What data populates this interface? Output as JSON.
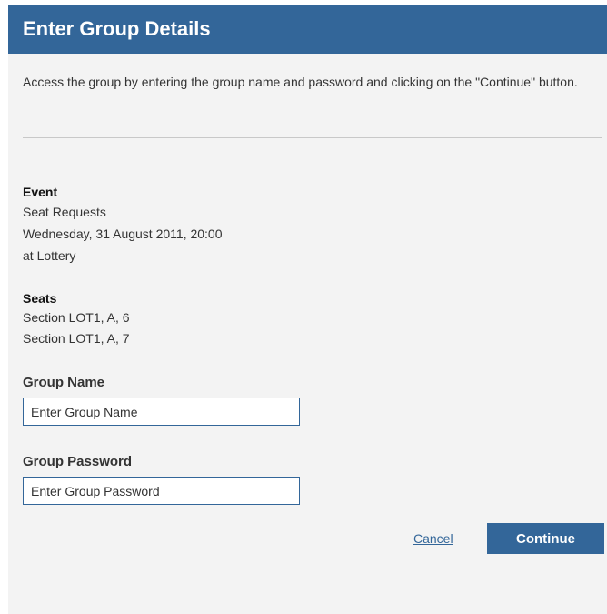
{
  "header": {
    "title": "Enter Group Details"
  },
  "intro": {
    "text": "Access the group by entering the group name and password and clicking on the \"Continue\" button."
  },
  "event": {
    "heading": "Event",
    "name": "Seat Requests",
    "datetime": "Wednesday, 31 August 2011, 20:00",
    "venue": "at Lottery"
  },
  "seats": {
    "heading": "Seats",
    "items": [
      "Section LOT1, A, 6",
      "Section LOT1, A, 7"
    ]
  },
  "group_name": {
    "label": "Group Name",
    "placeholder": "Enter Group Name",
    "value": ""
  },
  "group_password": {
    "label": "Group Password",
    "placeholder": "Enter Group Password",
    "value": ""
  },
  "actions": {
    "cancel_label": "Cancel",
    "continue_label": "Continue"
  },
  "colors": {
    "header_bg": "#336699",
    "panel_bg": "#f3f3f3",
    "button_bg": "#336699",
    "link": "#336699"
  }
}
